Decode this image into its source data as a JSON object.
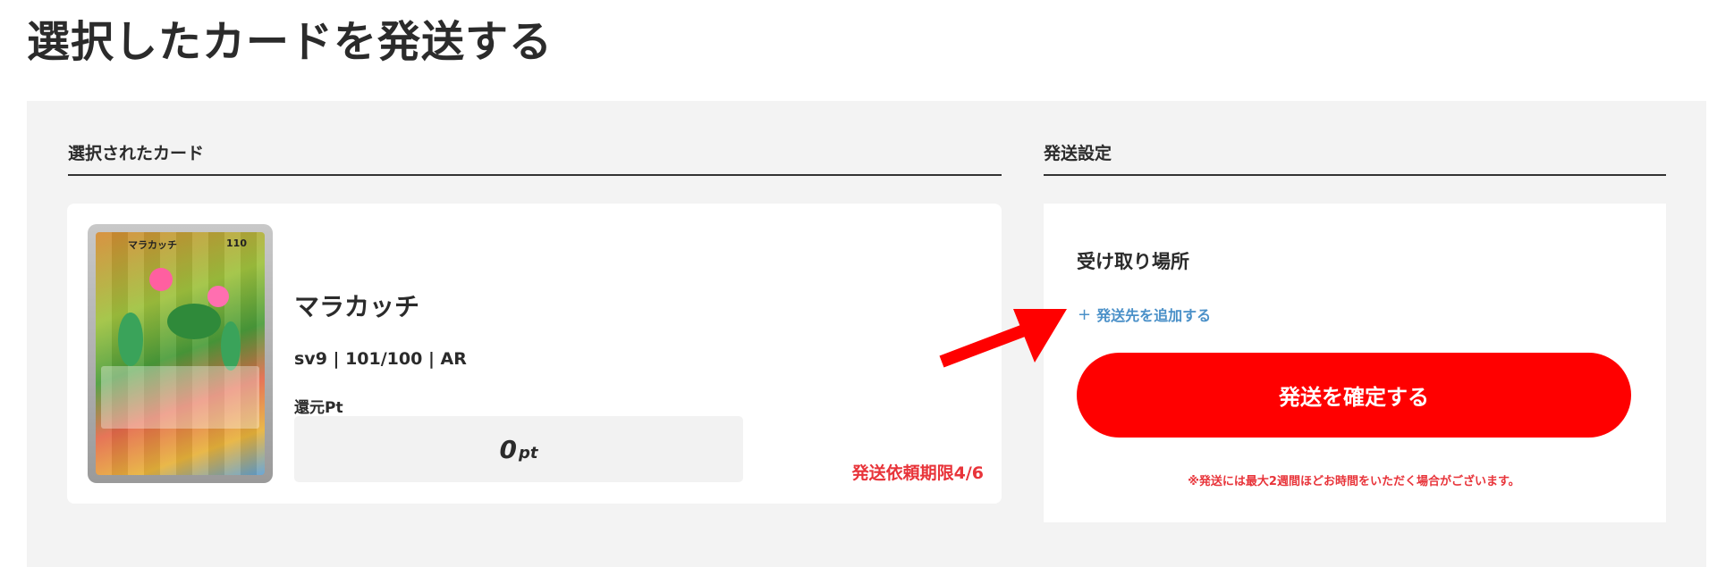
{
  "page": {
    "title": "選択したカードを発送する"
  },
  "selected": {
    "section_title": "選択されたカード",
    "card": {
      "image_name_text": "マラカッチ",
      "image_hp_text": "110",
      "name": "マラカッチ",
      "meta": "sv9 | 101/100 | AR",
      "points_label": "還元Pt",
      "points_value": "0",
      "points_unit": "pt",
      "deadline": "発送依頼期限4/6"
    }
  },
  "shipping": {
    "section_title": "発送設定",
    "receive_label": "受け取り場所",
    "add_link_plus": "+",
    "add_link_label": "発送先を追加する",
    "confirm_button": "発送を確定する",
    "note": "※発送には最大2週間ほどお時間をいただく場合がございます。"
  },
  "colors": {
    "accent_red": "#ff0000",
    "deadline_red": "#e8343a",
    "link_blue": "#4a90c8",
    "panel_gray": "#f3f3f3"
  },
  "icons": {
    "arrow": "red-arrow-icon",
    "plus": "plus-icon"
  }
}
